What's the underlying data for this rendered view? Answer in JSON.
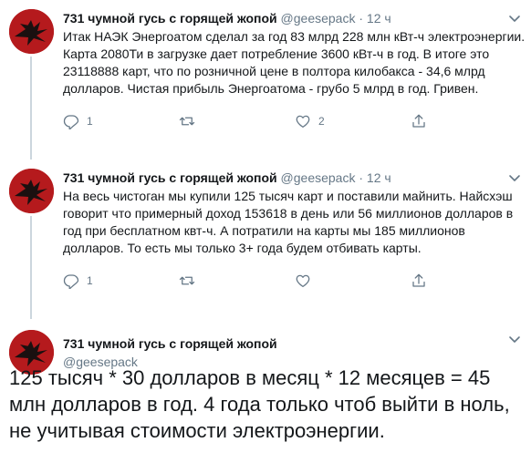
{
  "tweets": [
    {
      "name": "731 чумной гусь с горящей жопой",
      "handle": "@geesepack",
      "separator": "·",
      "time": "12 ч",
      "text": "Итак НАЭК Энергоатом сделал за год 83 млрд 228 млн кВт-ч электроэнергии. Карта 2080Ти в загрузке дает потребление 3600 кВт-ч в год. В итоге это 23118888 карт, что по розничной цене в полтора килобакса - 34,6 млрд долларов. Чистая прибыль Энергоатома - грубо 5 млрд в год. Гривен.",
      "reply_count": "1",
      "retweet_count": "",
      "like_count": "2",
      "share_count": ""
    },
    {
      "name": "731 чумной гусь с горящей жопой",
      "handle": "@geesepack",
      "separator": "·",
      "time": "12 ч",
      "text": "На весь чистоган мы купили 125 тысяч карт и поставили майнить. Найсхэш говорит что примерный доход 153618 в день или 56 миллионов долларов в год при бесплатном квт-ч. А потратили на карты мы 185 миллионов долларов. То есть мы только 3+ года будем отбивать карты.",
      "reply_count": "1",
      "retweet_count": "",
      "like_count": "",
      "share_count": ""
    }
  ],
  "main_tweet": {
    "name": "731 чумной гусь с горящей жопой",
    "handle": "@geesepack",
    "text": "125 тысяч * 30 долларов в месяц * 12 месяцев = 45 млн долларов в год. 4 года только чтоб выйти в ноль, не учитывая стоимости электроэнергии."
  },
  "icons": {
    "avatar": "red-bird-avatar",
    "caret": "chevron-down-icon",
    "reply": "reply-icon",
    "retweet": "retweet-icon",
    "like": "heart-icon",
    "share": "share-icon"
  },
  "colors": {
    "avatar_bg": "#b51a1d",
    "text": "#14171a",
    "secondary": "#657786",
    "thread_line": "#ccd6dd"
  }
}
